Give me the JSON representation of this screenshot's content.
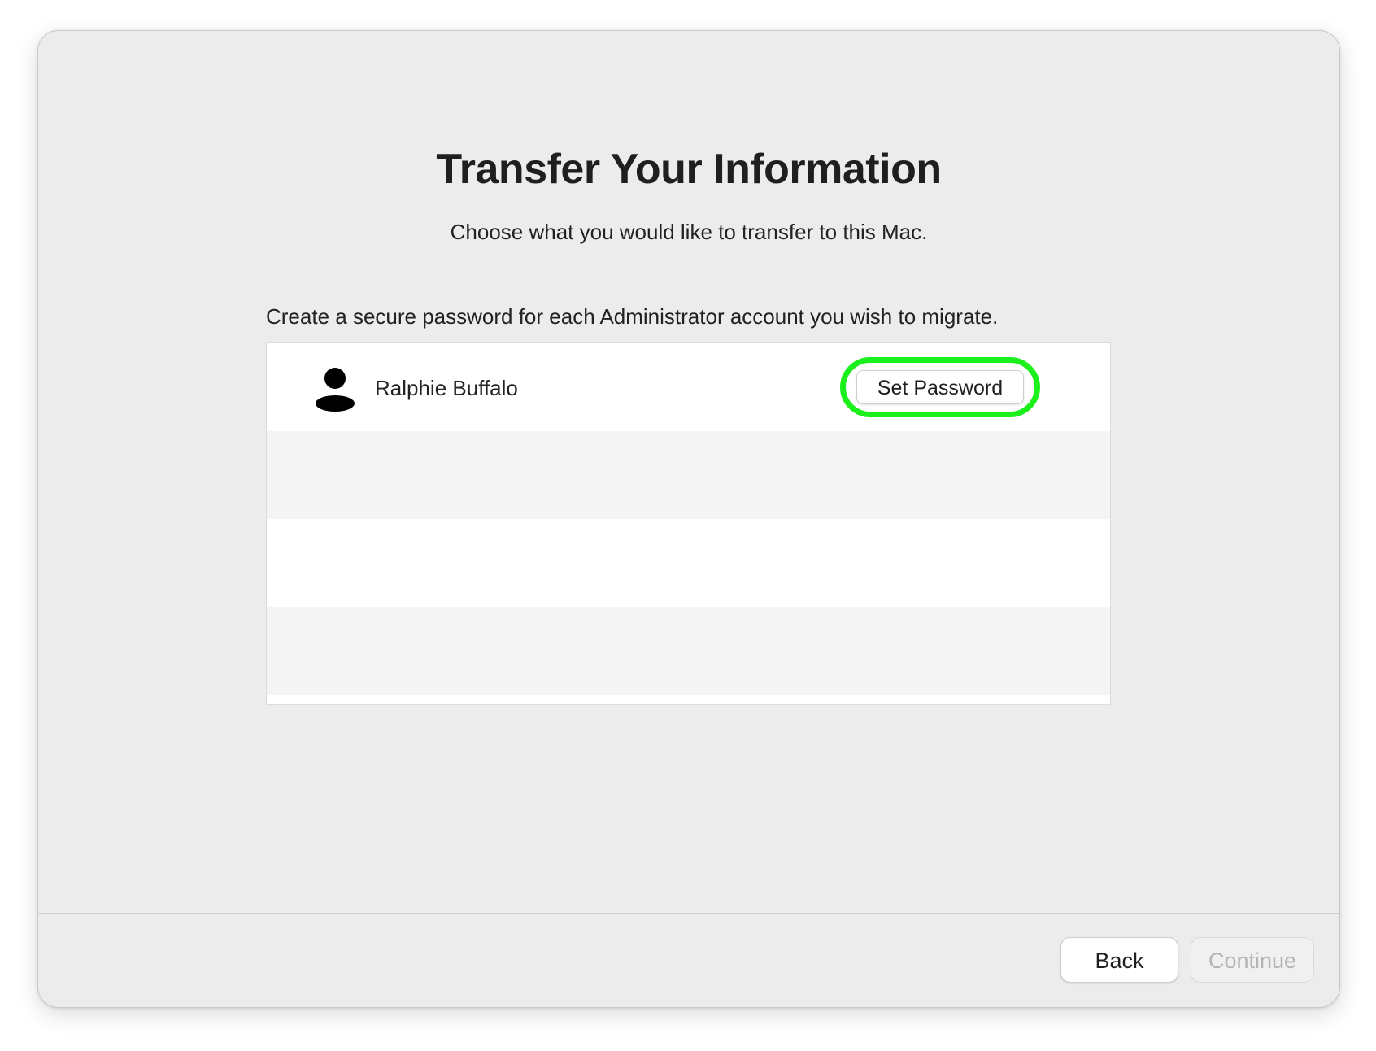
{
  "header": {
    "title": "Transfer Your Information",
    "subtitle": "Choose what you would like to transfer to this Mac."
  },
  "main": {
    "instructions": "Create a secure password for each Administrator account you wish to migrate.",
    "accounts": [
      {
        "name": "Ralphie Buffalo",
        "icon": "person-icon",
        "action_label": "Set Password",
        "highlighted": true
      }
    ],
    "highlight_color": "#1cf01c"
  },
  "footer": {
    "back_label": "Back",
    "continue_label": "Continue",
    "continue_enabled": false
  }
}
